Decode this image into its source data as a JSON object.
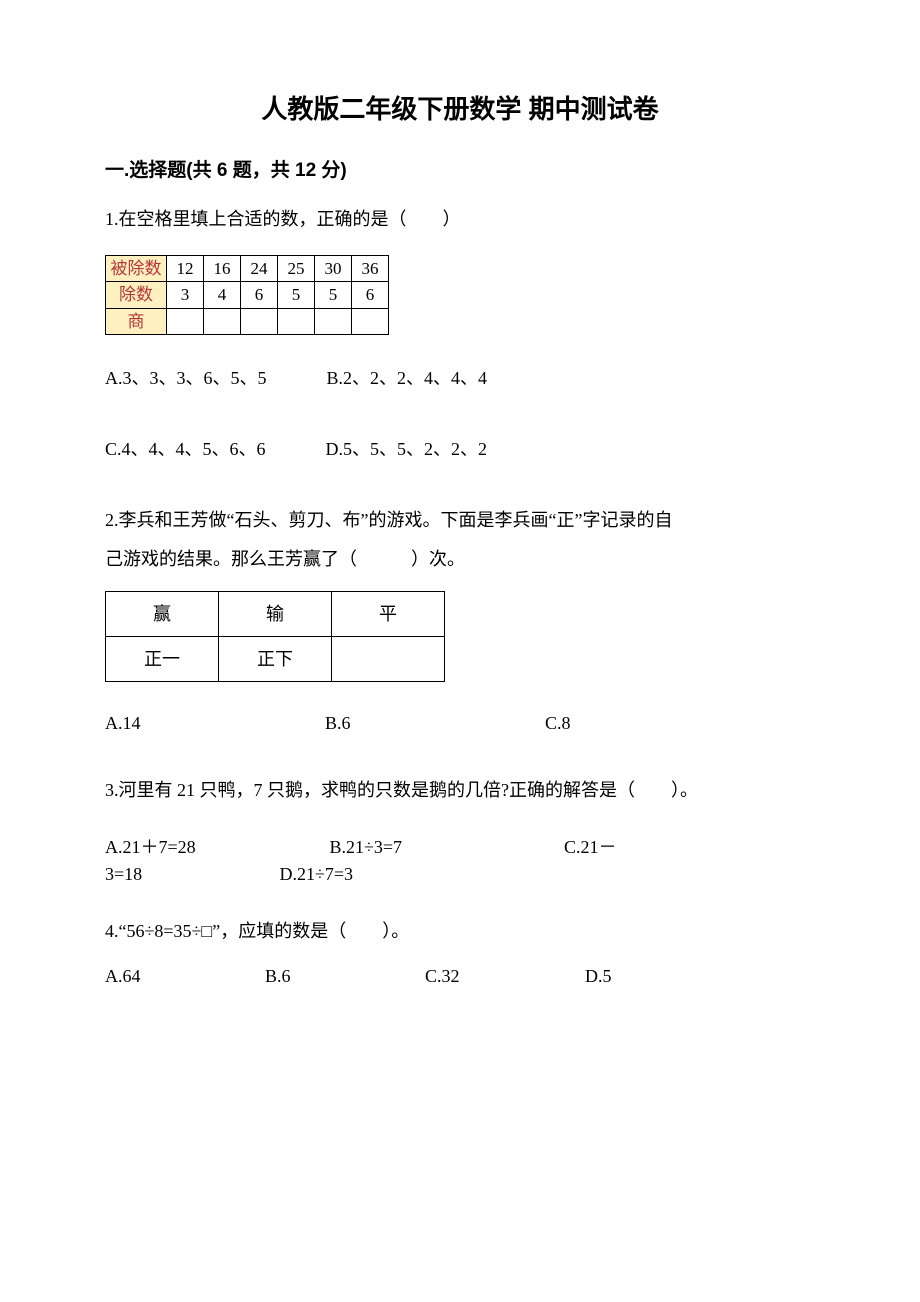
{
  "title": "人教版二年级下册数学 期中测试卷",
  "section": "一.选择题(共 6 题，共 12 分)",
  "q1": {
    "text": "1.在空格里填上合适的数，正确的是（　　）",
    "table": {
      "row1_label": "被除数",
      "row2_label": "除数",
      "row3_label": "商",
      "dividend": [
        "12",
        "16",
        "24",
        "25",
        "30",
        "36"
      ],
      "divisor": [
        "3",
        "4",
        "6",
        "5",
        "5",
        "6"
      ]
    },
    "opts": {
      "A": "A.3、3、3、6、5、5",
      "B": "B.2、2、2、4、4、4",
      "C": "C.4、4、4、5、6、6",
      "D": "D.5、5、5、2、2、2"
    }
  },
  "q2": {
    "text1": "2.李兵和王芳做“石头、剪刀、布”的游戏。下面是李兵画“正”字记录的自",
    "text2": "己游戏的结果。那么王芳赢了（　　　）次。",
    "table": {
      "h1": "赢",
      "h2": "输",
      "h3": "平",
      "c1": "正一",
      "c2": "正下",
      "c3": ""
    },
    "opts": {
      "A": "A.14",
      "B": "B.6",
      "C": "C.8"
    }
  },
  "q3": {
    "text": "3.河里有 21 只鸭，7 只鹅，求鸭的只数是鹅的几倍?正确的解答是（　　）。",
    "opts": {
      "A": "A.21＋7=28",
      "B": "B.21÷3=7",
      "C": "C.21－",
      "Cline2a": "3=18",
      "Cline2b": "D.21÷7=3"
    }
  },
  "q4": {
    "text": "4.“56÷8=35÷□”，应填的数是（　　）。",
    "opts": {
      "A": "A.64",
      "B": "B.6",
      "C": "C.32",
      "D": "D.5"
    }
  }
}
